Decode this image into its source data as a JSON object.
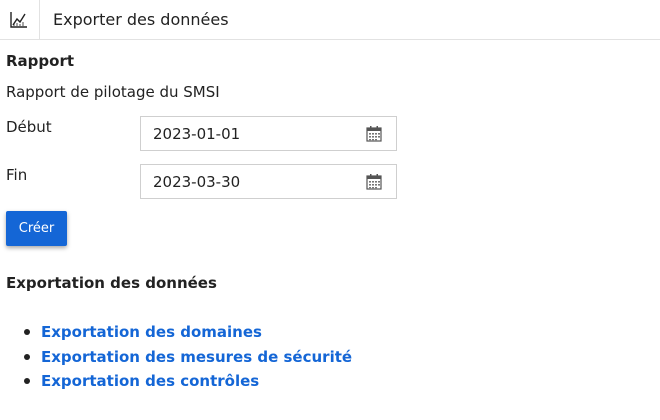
{
  "header": {
    "icon": "chart-line-icon",
    "title": "Exporter des données"
  },
  "report": {
    "heading": "Rapport",
    "description": "Rapport de pilotage du SMSI",
    "start_label": "Début",
    "start_value": "2023-01-01",
    "end_label": "Fin",
    "end_value": "2023-03-30",
    "calendar_icon": "calendar-icon",
    "create_label": "Créer"
  },
  "export": {
    "heading": "Exportation des données",
    "links": [
      "Exportation des domaines",
      "Exportation des mesures de sécurité",
      "Exportation des contrôles"
    ]
  },
  "colors": {
    "accent": "#1466d6",
    "text": "#222222",
    "border": "#cfcfcf"
  }
}
